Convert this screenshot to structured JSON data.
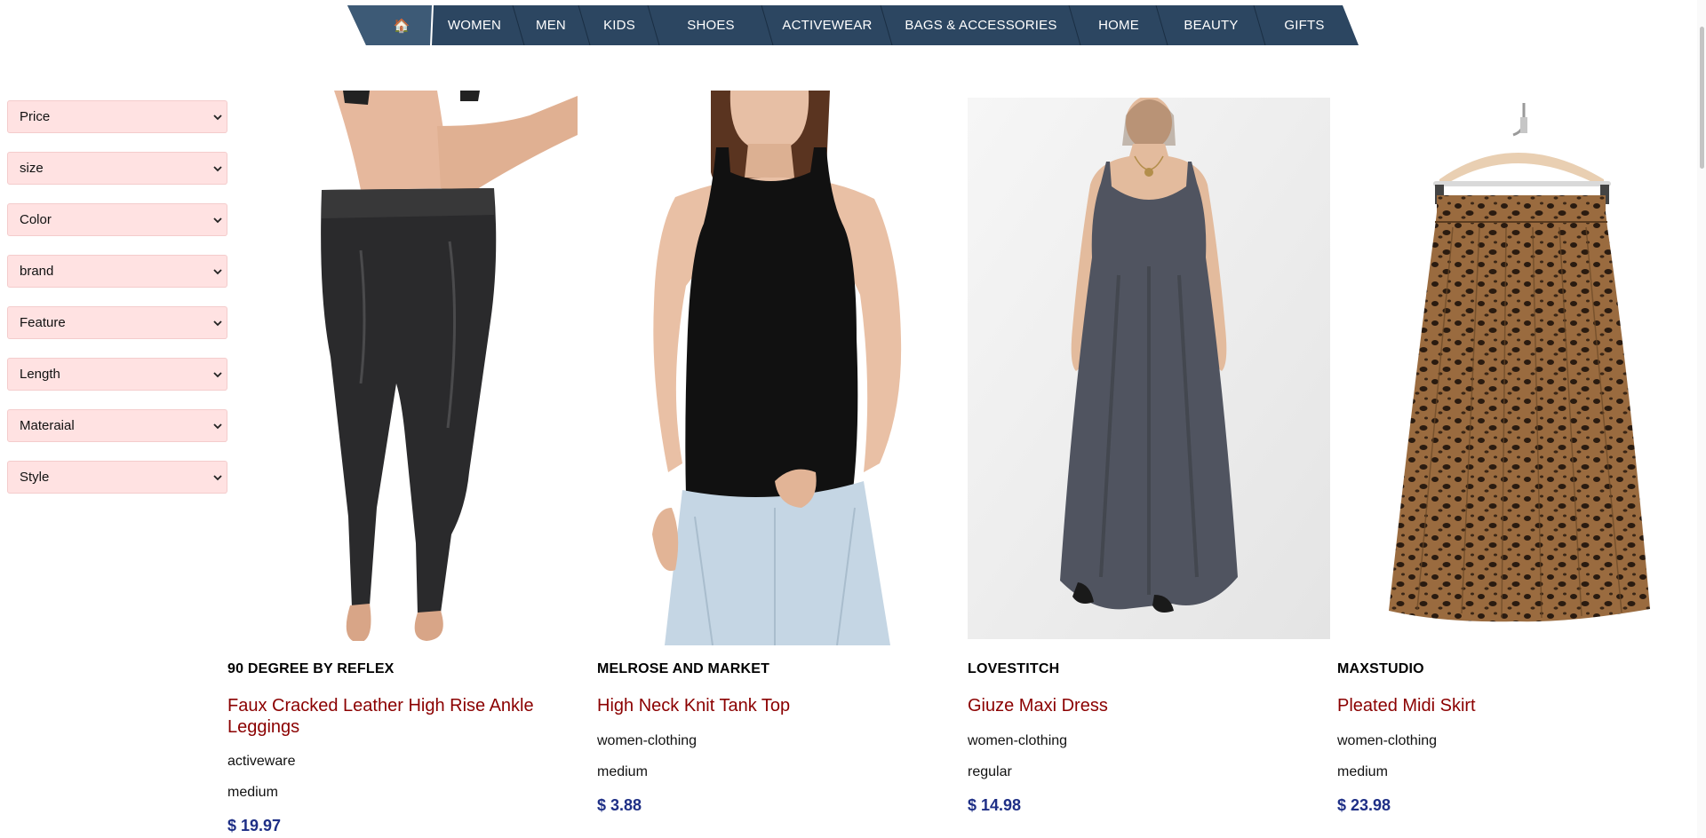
{
  "nav": {
    "home_icon": "house-icon",
    "items": [
      "WOMEN",
      "MEN",
      "KIDS",
      "SHOES",
      "ACTIVEWEAR",
      "BAGS & ACCESSORIES",
      "HOME",
      "BEAUTY",
      "GIFTS"
    ],
    "background": "#2c4661",
    "home_background": "#3d5a76"
  },
  "filters": [
    {
      "label": "Price"
    },
    {
      "label": "size"
    },
    {
      "label": "Color"
    },
    {
      "label": "brand"
    },
    {
      "label": "Feature"
    },
    {
      "label": "Length"
    },
    {
      "label": "Materaial"
    },
    {
      "label": "Style"
    }
  ],
  "filter_background": "#ffe2e2",
  "products": [
    {
      "brand": "90 DEGREE BY REFLEX",
      "title": "Faux Cracked Leather High Rise Ankle Leggings",
      "category": "activeware",
      "size": "medium",
      "price": "$ 19.97",
      "image": "leggings-photo"
    },
    {
      "brand": "MELROSE AND MARKET",
      "title": "High Neck Knit Tank Top",
      "category": "women-clothing",
      "size": "medium",
      "price": "$ 3.88",
      "image": "tank-top-photo"
    },
    {
      "brand": "LOVESTITCH",
      "title": "Giuze Maxi Dress",
      "category": "women-clothing",
      "size": "regular",
      "price": "$ 14.98",
      "image": "maxi-dress-photo"
    },
    {
      "brand": "MAXSTUDIO",
      "title": "Pleated Midi Skirt",
      "category": "women-clothing",
      "size": "medium",
      "price": "$ 23.98",
      "image": "leopard-skirt-photo"
    }
  ],
  "colors": {
    "title": "#8b0000",
    "price": "#1e2f86"
  }
}
